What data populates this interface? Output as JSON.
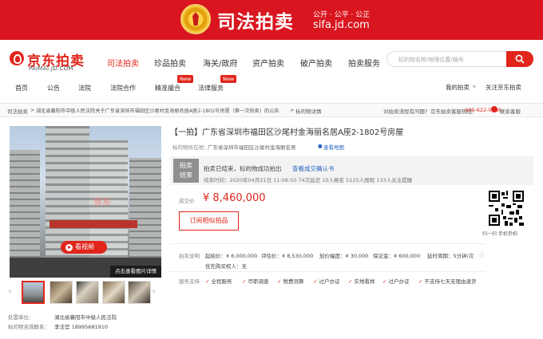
{
  "banner": {
    "title": "司法拍卖",
    "slogan": "公开 · 公平 · 公正",
    "url": "sifa.jd.com"
  },
  "logo": {
    "cn": "京东拍卖",
    "en": "PAIMAI.JD.COM"
  },
  "main_nav": [
    "司法拍卖",
    "珍品拍卖",
    "海关/政府",
    "资产拍卖",
    "破产拍卖",
    "拍卖服务"
  ],
  "search": {
    "placeholder": "标的物名称/地理位置/编号"
  },
  "sub_nav": [
    "首页",
    "公告",
    "法院",
    "法院合作",
    "精准撮合",
    "法律服务"
  ],
  "new_badge": "New",
  "sub_nav_right": {
    "my_auction": "我的拍卖",
    "follow": "关注京东拍卖"
  },
  "breadcrumb": {
    "root": "司法拍卖",
    "sep": ">",
    "court": "湖北省襄阳市中级人民法院关于广东省深圳市福田区沙尾村金海丽名居A座2-1802号房屋（第一次拍卖）的公告",
    "detail": "标的物详情"
  },
  "hotline": {
    "flow": "对拍卖流程有问题？",
    "label": "京东拍卖客服热线：",
    "number": "400-622-0586",
    "cs": "联系客服"
  },
  "photo": {
    "watermark": "京东",
    "video": "看视频",
    "big": "点击查看图片详情"
  },
  "disposal": {
    "unit_label": "处置单位：",
    "unit": "湖北省襄阳市中级人民法院",
    "contact_label": "标的物咨询联系：",
    "contact": "李法官 18995681910"
  },
  "item": {
    "title": "【一拍】广东省深圳市福田区沙尾村金海丽名居A座2-1802号房屋",
    "loc_label": "标的物所在地：",
    "loc": "广东省深圳市福田区沙尾村金海丽名居",
    "map": "查看地图"
  },
  "status": {
    "line1": "拍卖",
    "line2": "结束",
    "main": "拍卖已结束，标的物成功拍出",
    "link": "查看成交确认书",
    "stats": "结束时间：2020年04月21日 11:08:50    74次延迟    10人报名    5125人围观    133人关注提醒"
  },
  "price": {
    "label": "成交价",
    "value": "¥ 8,460,000"
  },
  "subscribe": "订阅相似拍品",
  "qr_label": "扫一扫 手机参拍",
  "params": {
    "label": "拍卖说明",
    "items": [
      "起拍价：¥ 6,000,000",
      "评估价：¥ 8,530,000",
      "加价幅度：¥ 30,000",
      "保证金：¥ 600,000",
      "延时周期：5分钟/次"
    ],
    "priority": "优先购买权人：无"
  },
  "services": {
    "label": "服务支持",
    "items": [
      "全程服务",
      "尽职调查",
      "税费测算",
      "过户办证",
      "实地看样",
      "过户办证",
      "不支持七天无理由退货"
    ]
  }
}
